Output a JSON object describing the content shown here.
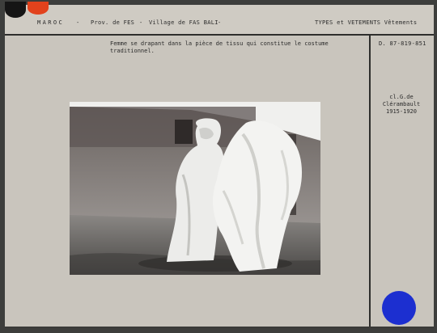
{
  "header": {
    "country": "MAROC",
    "sep": "-",
    "province": "Prov. de FES",
    "village": "Village de FAS BALI",
    "category": "TYPES et VETEMENTS  Vêtements"
  },
  "caption": "Femme se drapant dans la pièce de tissu qui constitue le costume\ntraditionnel.",
  "reference": "D. 87-819-851",
  "credit": {
    "author": "cl.G.de Clérambault",
    "years": "1915-1920"
  },
  "colors": {
    "corner_dot_left": "#151515",
    "corner_dot_right": "#e2421c",
    "blue_dot": "#1c2fd0"
  }
}
